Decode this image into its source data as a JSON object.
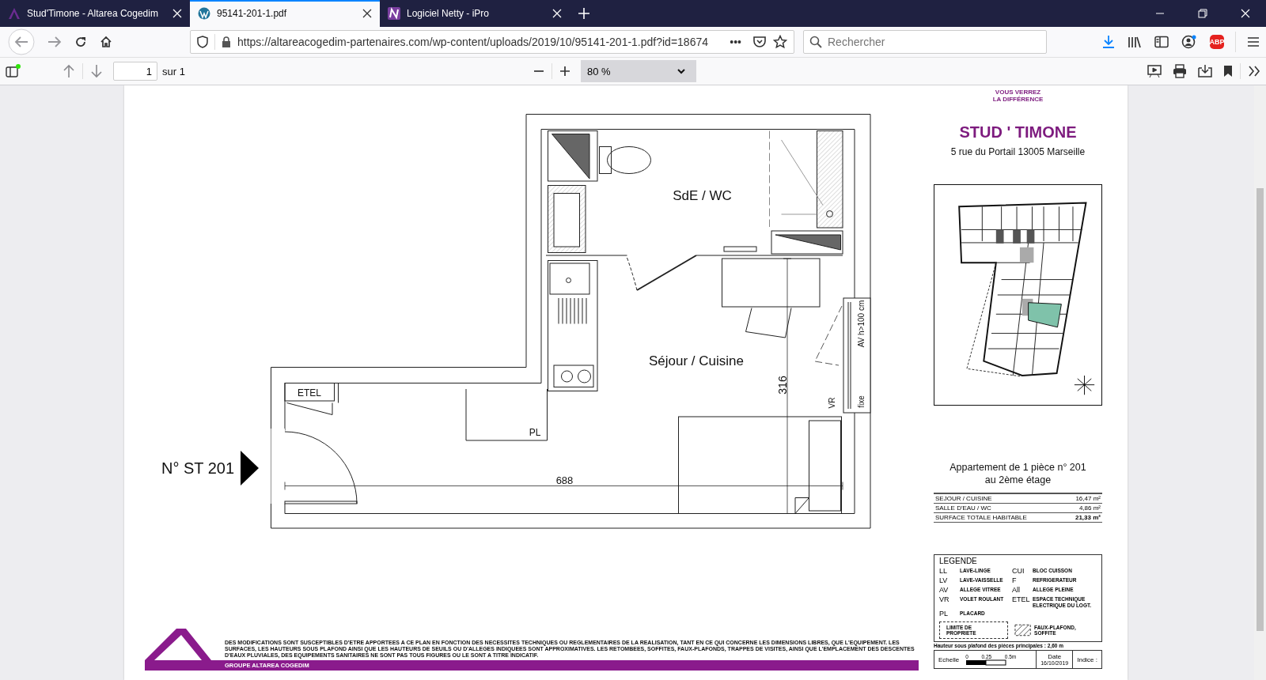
{
  "tabs": [
    {
      "title": "Stud'Timone - Altarea Cogedim",
      "selected": false
    },
    {
      "title": "95141-201-1.pdf",
      "selected": true
    },
    {
      "title": "Logiciel Netty - iPro",
      "selected": false
    }
  ],
  "navigation": {
    "url": "https://altareacogedim-partenaires.com/wp-content/uploads/2019/10/95141-201-1.pdf?id=18674",
    "page_actions": "•••",
    "search": {
      "placeholder": "Rechercher"
    },
    "adblock_badge": "ABP"
  },
  "pdf_toolbar": {
    "page": "1",
    "page_total": "sur 1",
    "zoom": "80 %"
  },
  "document": {
    "unit_label": "N° ST 201",
    "plan_labels": [
      "SdE / WC",
      "Séjour / Cuisine",
      "ETEL",
      "PL",
      "688",
      "316",
      "AV h>100 cm",
      "VR",
      "fixe"
    ],
    "slogan": [
      "VOUS VERREZ",
      "LA DIFFÉRENCE"
    ],
    "title": "STUD ' TIMONE",
    "address": "5 rue du Portail 13005 Marseille",
    "apartment": [
      "Appartement de 1 pièce n° 201",
      "au 2ème étage"
    ],
    "areas": [
      {
        "room": "SEJOUR / CUISINE",
        "area": "16,47 m²",
        "kind": "room"
      },
      {
        "room": "SALLE D'EAU / WC",
        "area": "4,86 m²",
        "kind": "room"
      },
      {
        "room": "SURFACE TOTALE HABITABLE",
        "area": "21,33 m²",
        "kind": "total"
      }
    ],
    "legend": {
      "title": "LEGENDE",
      "items": [
        {
          "code": "LL",
          "label": "LAVE-LINGE"
        },
        {
          "code": "CUI",
          "label": "BLOC CUISSON"
        },
        {
          "code": "LV",
          "label": "LAVE-VAISSELLE"
        },
        {
          "code": "F",
          "label": "REFRIGERATEUR"
        },
        {
          "code": "AV",
          "label": "ALLEGE VITREE"
        },
        {
          "code": "All",
          "label": "ALLEGE PLEINE"
        },
        {
          "code": "VR",
          "label": "VOLET ROULANT"
        },
        {
          "code": "ETEL",
          "label": "ESPACE TECHNIQUE ELECTRIQUE DU LOGT."
        },
        {
          "code": "PL",
          "label": "PLACARD"
        }
      ],
      "boundary": "LIMITE DE PROPRIETE",
      "hatch": "FAUX-PLAFOND, SOFFITE"
    },
    "ceiling_note": "Hauteur sous plafond des pièces principales : 2,60 m",
    "scale": {
      "label": "Echelle",
      "ticks": [
        "0",
        "0.25",
        "0.5m"
      ]
    },
    "date": {
      "label": "Date",
      "value": "16/10/2019"
    },
    "index_label": "Indice :",
    "disclaimer": "DES MODIFICATIONS SONT SUSCEPTIBLES D'ETRE APPORTEES A CE PLAN EN FONCTION DES NECESSITES TECHNIQUES OU REGLEMENTAIRES DE LA REALISATION, TANT EN CE QUI CONCERNE LES DIMENSIONS LIBRES, QUE L'EQUIPEMENT. LES SURFACES, LES HAUTEURS SOUS PLAFOND AINSI QUE LES HAUTEURS DE SEUILS OU D'ALLEGES INDIQUEES SONT APPROXIMATIVES. LES RETOMBEES, SOFFITES, FAUX-PLAFONDS, TRAPPES DE VISITES, AINSI QUE L'EMPLACEMENT DES DESCENTES D'EAUX PLUVIALES, DES EQUIPEMENTS SANITAIRES NE SONT PAS TOUS FIGURES OU LE SONT A TITRE INDICATIF.",
    "company": "GROUPE ALTAREA COGEDIM"
  }
}
